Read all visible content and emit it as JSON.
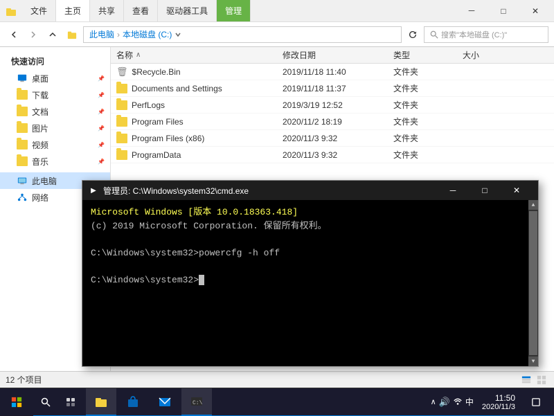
{
  "explorer": {
    "title": "本地磁盘 (C:)",
    "tabs": [
      {
        "label": "文件",
        "active": false
      },
      {
        "label": "主页",
        "active": true
      },
      {
        "label": "共享",
        "active": false
      },
      {
        "label": "查看",
        "active": false
      },
      {
        "label": "驱动器工具",
        "active": false
      },
      {
        "label": "管理",
        "active": false,
        "highlight": true
      }
    ],
    "address": {
      "back": "←",
      "forward": "→",
      "up": "↑",
      "path_parts": [
        "此电脑",
        "本地磁盘 (C:)"
      ],
      "refresh": "⟳",
      "search_placeholder": "搜索\"本地磁盘 (C:)\""
    },
    "sidebar": {
      "sections": [
        {
          "header": "快速访问",
          "items": [
            {
              "label": "桌面",
              "icon": "folder",
              "pinned": true
            },
            {
              "label": "下载",
              "icon": "folder",
              "pinned": true
            },
            {
              "label": "文档",
              "icon": "folder",
              "pinned": true
            },
            {
              "label": "图片",
              "icon": "folder",
              "pinned": true
            },
            {
              "label": "视频",
              "icon": "folder",
              "pinned": true
            },
            {
              "label": "音乐",
              "icon": "folder",
              "pinned": true
            }
          ]
        },
        {
          "header": "",
          "items": [
            {
              "label": "此电脑",
              "icon": "computer",
              "active": true
            },
            {
              "label": "网络",
              "icon": "network"
            }
          ]
        }
      ]
    },
    "file_list": {
      "columns": [
        {
          "label": "名称",
          "sort": "asc"
        },
        {
          "label": "修改日期"
        },
        {
          "label": "类型"
        },
        {
          "label": "大小"
        }
      ],
      "files": [
        {
          "name": "$Recycle.Bin",
          "date": "2019/11/18 11:40",
          "type": "文件夹",
          "size": "",
          "icon": "recycle"
        },
        {
          "name": "Documents and Settings",
          "date": "2019/11/18 11:37",
          "type": "文件夹",
          "size": "",
          "icon": "folder"
        },
        {
          "name": "PerfLogs",
          "date": "2019/3/19 12:52",
          "type": "文件夹",
          "size": "",
          "icon": "folder"
        },
        {
          "name": "Program Files",
          "date": "2020/11/2 18:19",
          "type": "文件夹",
          "size": "",
          "icon": "folder"
        },
        {
          "name": "Program Files (x86)",
          "date": "2020/11/3 9:32",
          "type": "文件夹",
          "size": "",
          "icon": "folder"
        },
        {
          "name": "ProgramData",
          "date": "2020/11/3 9:32",
          "type": "文件夹",
          "size": "",
          "icon": "folder"
        }
      ]
    },
    "status": {
      "count": "12 个项目"
    }
  },
  "cmd": {
    "title": "管理员: C:\\Windows\\system32\\cmd.exe",
    "icon": "▶",
    "lines": [
      "Microsoft Windows [版本 10.0.18363.418]",
      "(c) 2019 Microsoft Corporation. 保留所有权利。",
      "",
      "C:\\Windows\\system32>powercfg -h off",
      "",
      "C:\\Windows\\system32>"
    ],
    "highlight_range": [
      0,
      0
    ],
    "controls": {
      "minimize": "－",
      "maximize": "□",
      "close": "✕"
    }
  },
  "taskbar": {
    "apps": [
      {
        "name": "start",
        "icon": "⊞"
      },
      {
        "name": "search",
        "icon": "🔍"
      },
      {
        "name": "task-view",
        "icon": "❐"
      },
      {
        "name": "explorer",
        "icon": "📁",
        "active": true
      },
      {
        "name": "store",
        "icon": "🛍"
      },
      {
        "name": "mail",
        "icon": "✉"
      },
      {
        "name": "cmd",
        "icon": "■",
        "active": true
      }
    ],
    "tray": {
      "show_hidden": "∧",
      "speaker": "🔊",
      "ime": "中",
      "time": "11:50",
      "date": "2020/11/3",
      "notification": "⬜"
    }
  },
  "window_controls": {
    "minimize": "－",
    "maximize": "□",
    "close": "✕"
  }
}
